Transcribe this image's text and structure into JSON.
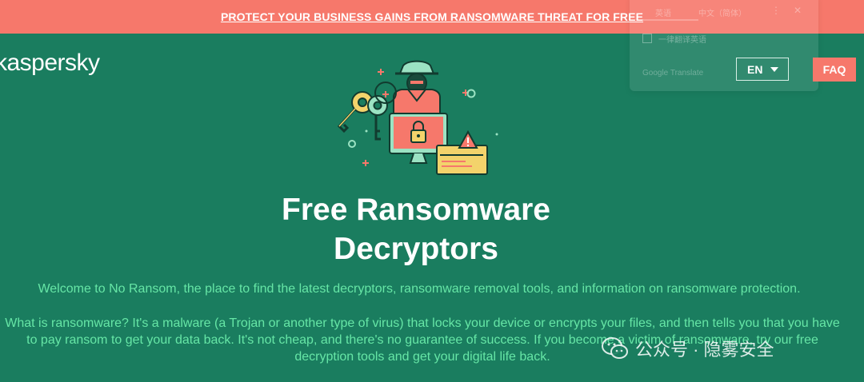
{
  "promo": {
    "text": "PROTECT YOUR BUSINESS GAINS FROM RANSOMWARE THREAT FOR FREE"
  },
  "header": {
    "logo": "kaspersky",
    "language": "EN",
    "faq_label": "FAQ"
  },
  "translate_widget": {
    "tab_english": "英语",
    "tab_chinese": "中文（简体）",
    "more_icon": "⋮",
    "close_icon": "✕",
    "checkbox_label": "一律翻译英语",
    "brand": "Google Translate"
  },
  "hero": {
    "title_line1": "Free Ransomware",
    "title_line2": "Decryptors"
  },
  "content": {
    "intro": "Welcome to No Ransom, the place to find the latest decryptors, ransomware removal tools, and information on ransomware protection.",
    "desc_line1": "What is ransomware? It's a malware (a Trojan or another type of virus) that locks your device or encrypts your files, and then tells you that you have",
    "desc_line2": "to pay ransom to get your data back. It's not cheap, and there's no guarantee of success. If you become a victim of ransomware, try our free",
    "desc_line3": "decryption tools and get your digital life back."
  },
  "watermark": {
    "text": "公众号 · 隐雾安全"
  },
  "colors": {
    "background": "#1a7d5f",
    "accent": "#f6786b",
    "text_green": "#66e6a6"
  }
}
